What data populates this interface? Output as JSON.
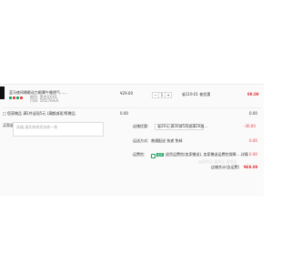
{
  "product": {
    "name": "蓝马夜间睡眠动力眼罩午睡透气……",
    "spec_line1": "颜色: 黑色XXXX",
    "spec_line2": "尺码: 165/76A/S",
    "unit_price": "¥29.00",
    "quantity": "1",
    "minus": "−",
    "plus": "+",
    "discount": "省119.01 查优惠",
    "total": "99.09",
    "sku_colors": [
      "#1aa260",
      "#e4393c",
      "#1aa260",
      "#e4393c"
    ]
  },
  "gift_row": {
    "label": "□ 您获赠品 满1件返现5元 (满额减现)等赠品",
    "value": "0.00"
  },
  "notes": {
    "label": "买家留言:",
    "placeholder": "选填,请先和商家协商一致"
  },
  "store_discount": {
    "label": "店铺优惠:",
    "option": "省20元:满30减5再减满20减…",
    "value": "-30.00"
  },
  "shipping": {
    "label": "运送方式:",
    "option": "普通配送 快递 免邮",
    "value": "0.00"
  },
  "insurance": {
    "label": "运费险:",
    "tag": "卖家",
    "text": "退货运费险(卖家赠送), 卖家赠送运费险保障 …详情",
    "value": "0.00"
  },
  "summary": {
    "label": "店铺合计(含运费)",
    "value": "¥69.99"
  },
  "watermark": "@值得买 值得买 值得买"
}
